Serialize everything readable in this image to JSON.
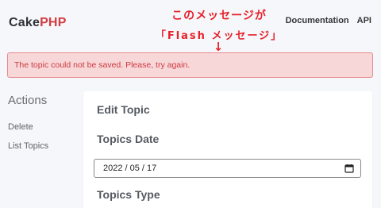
{
  "header": {
    "brand_part1": "Cake",
    "brand_part2": "PHP",
    "nav": [
      "Documentation",
      "API"
    ]
  },
  "annotation": {
    "line1": "このメッセージが",
    "line2": "「Flash メッセージ」",
    "arrow": "↓",
    "color": "#e8202a"
  },
  "flash": {
    "message": "The topic could not be saved. Please, try again.",
    "background": "#f8d7d8",
    "text_color": "#cc3a40"
  },
  "sidebar": {
    "heading": "Actions",
    "items": [
      "Delete",
      "List Topics"
    ]
  },
  "form": {
    "title": "Edit Topic",
    "date_label": "Topics Date",
    "date_value": "2022 / 05 / 17",
    "date_icon": "calendar-icon",
    "type_label": "Topics Type"
  },
  "colors": {
    "brand_accent": "#d33c43",
    "page_background": "#f5f7fa"
  }
}
